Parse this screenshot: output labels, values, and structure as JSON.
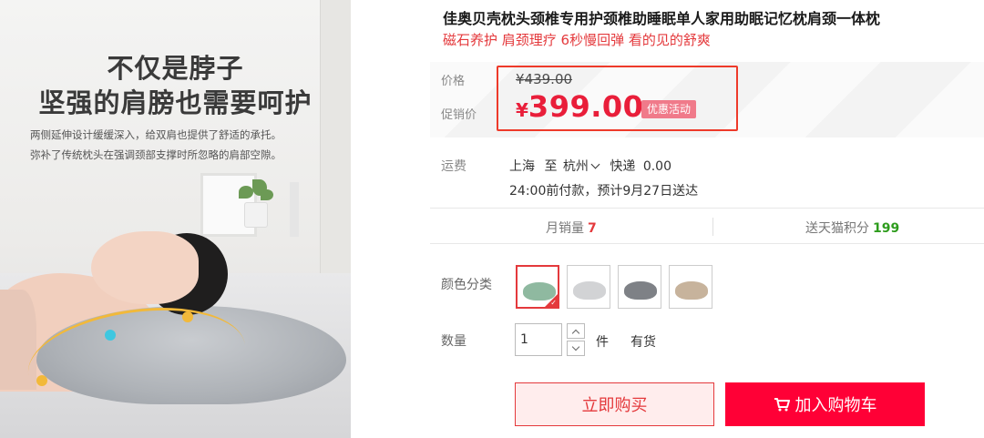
{
  "product_image": {
    "headline_line1": "不仅是脖子",
    "headline_line2": "坚强的肩膀也需要呵护",
    "sub_line1": "两侧延伸设计缓缓深入，给双肩也提供了舒适的承托。",
    "sub_line2": "弥补了传统枕头在强调颈部支撑时所忽略的肩部空隙。"
  },
  "title": "佳奥贝壳枕头颈椎专用护颈椎助睡眠单人家用助眠记忆枕肩颈一体枕",
  "subtitle": "磁石养护 肩颈理疗 6秒慢回弹 看的见的舒爽",
  "price": {
    "label_price": "价格",
    "original": "¥439.00",
    "label_promo": "促销价",
    "currency": "¥",
    "promo": "399.00",
    "badge": "优惠活动",
    "highlight_color": "#ee3a2a",
    "price_color": "#e91e3a"
  },
  "shipping": {
    "label": "运费",
    "origin": "上海",
    "to": "至",
    "destination": "杭州",
    "method": "快递",
    "fee": "0.00",
    "delivery_note": "24:00前付款，预计9月27日送达"
  },
  "stats": {
    "monthly_sales_label": "月销量",
    "monthly_sales_value": "7",
    "points_label": "送天猫积分",
    "points_value": "199"
  },
  "color": {
    "label": "颜色分类",
    "options": [
      {
        "name": "color-option-green",
        "pillow_color": "#8fb9a0",
        "selected": true
      },
      {
        "name": "color-option-light-gray",
        "pillow_color": "#d2d3d5",
        "selected": false
      },
      {
        "name": "color-option-dark-gray",
        "pillow_color": "#7e8186",
        "selected": false
      },
      {
        "name": "color-option-beige",
        "pillow_color": "#c7b39c",
        "selected": false
      }
    ]
  },
  "quantity": {
    "label": "数量",
    "value": "1",
    "unit": "件",
    "stock": "有货"
  },
  "buttons": {
    "buy_now": "立即购买",
    "add_to_cart": "加入购物车"
  },
  "colors": {
    "accent_red": "#e4393c",
    "cart_button": "#ff0036",
    "points_green": "#2e9c1d"
  }
}
